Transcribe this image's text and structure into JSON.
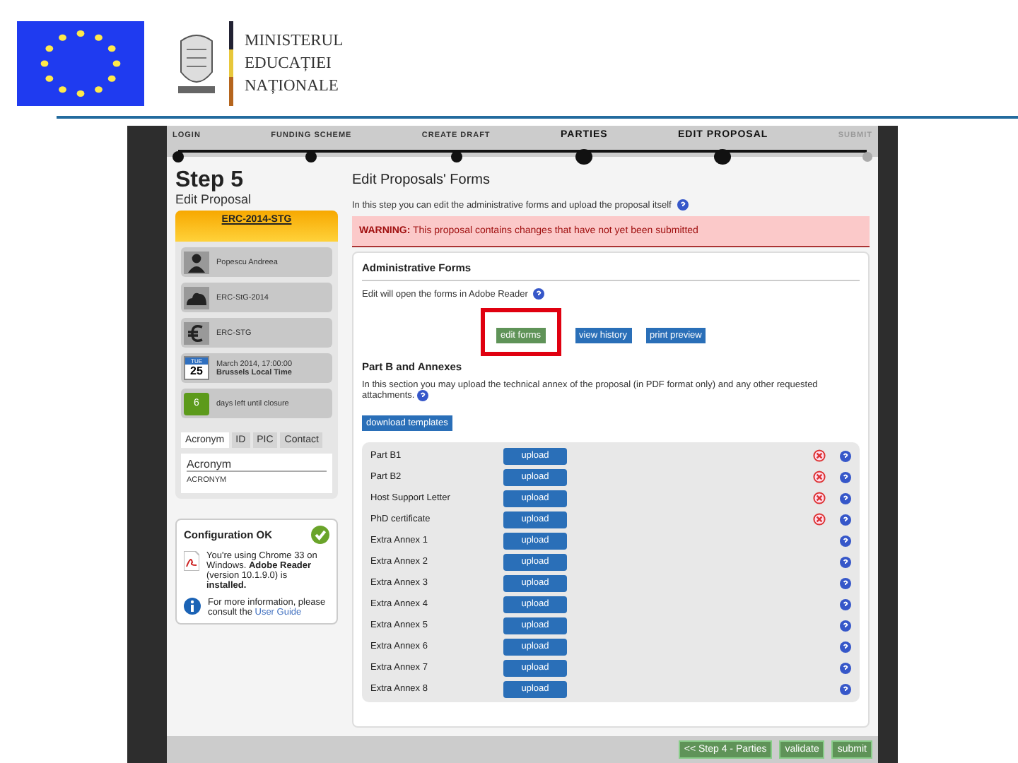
{
  "header": {
    "ministry_lines": [
      "MINISTERUL",
      "EDUCAȚIEI",
      "NAȚIONALE"
    ]
  },
  "stepper": [
    {
      "label": "LOGIN",
      "current": false,
      "disabled": false
    },
    {
      "label": "FUNDING SCHEME",
      "current": false,
      "disabled": false
    },
    {
      "label": "CREATE DRAFT",
      "current": false,
      "disabled": false
    },
    {
      "label": "PARTIES",
      "current": true,
      "disabled": false
    },
    {
      "label": "EDIT PROPOSAL",
      "current": true,
      "disabled": false
    },
    {
      "label": "SUBMIT",
      "current": false,
      "disabled": true
    }
  ],
  "sidebar": {
    "step_title": "Step 5",
    "step_subtitle": "Edit Proposal",
    "call": "ERC-2014-STG",
    "items": [
      {
        "kind": "person",
        "text": "Popescu Andreea"
      },
      {
        "kind": "cloud",
        "text": "ERC-StG-2014"
      },
      {
        "kind": "euro",
        "text": "ERC-STG"
      },
      {
        "kind": "calendar",
        "weekday": "TUE",
        "day": "25",
        "text": "March 2014, 17:00:00",
        "subtext": "Brussels Local Time"
      },
      {
        "kind": "countdown",
        "badge": "6",
        "text": "days left until closure"
      }
    ],
    "tabs": [
      {
        "label": "Acronym",
        "selected": true
      },
      {
        "label": "ID",
        "selected": false
      },
      {
        "label": "PIC",
        "selected": false
      },
      {
        "label": "Contact",
        "selected": false
      }
    ],
    "field_label": "Acronym",
    "field_value": "ACRONYM",
    "config": {
      "title": "Configuration OK",
      "ok": true,
      "message": "You're using Chrome 33 on Windows. **Adobe Reader** (version 10.1.9.0) is **installed.**",
      "info": "For more information, please consult the",
      "link": "User Guide"
    }
  },
  "main": {
    "title": "Edit Proposals' Forms",
    "intro": "In this step you can edit the administrative forms and upload the proposal itself",
    "warning": "**WARNING:** This proposal contains changes that have not yet been submitted",
    "admin_title": "Administrative Forms",
    "admin_text": "Edit will open the forms in Adobe Reader",
    "admin_buttons": [
      {
        "label": "edit forms",
        "kind": "primary",
        "highlighted": true
      },
      {
        "label": "view history",
        "kind": "secondary",
        "highlighted": false
      },
      {
        "label": "print preview",
        "kind": "secondary",
        "highlighted": false
      }
    ],
    "partb_title": "Part B and Annexes",
    "partb_text": "In this section you may upload the technical annex of the proposal (in PDF format only) and any other requested attachments.",
    "download_button": "download templates",
    "uploads": [
      {
        "label": "Part B1",
        "button": "upload",
        "missing": true
      },
      {
        "label": "Part B2",
        "button": "upload",
        "missing": true
      },
      {
        "label": "Host Support Letter",
        "button": "upload",
        "missing": true
      },
      {
        "label": "PhD certificate",
        "button": "upload",
        "missing": true
      },
      {
        "label": "Extra Annex 1",
        "button": "upload",
        "missing": false
      },
      {
        "label": "Extra Annex 2",
        "button": "upload",
        "missing": false
      },
      {
        "label": "Extra Annex 3",
        "button": "upload",
        "missing": false
      },
      {
        "label": "Extra Annex 4",
        "button": "upload",
        "missing": false
      },
      {
        "label": "Extra Annex 5",
        "button": "upload",
        "missing": false
      },
      {
        "label": "Extra Annex 6",
        "button": "upload",
        "missing": false
      },
      {
        "label": "Extra Annex 7",
        "button": "upload",
        "missing": false
      },
      {
        "label": "Extra Annex 8",
        "button": "upload",
        "missing": false
      }
    ]
  },
  "footer": {
    "buttons": [
      "<< Step 4 - Parties",
      "validate",
      "submit"
    ]
  }
}
